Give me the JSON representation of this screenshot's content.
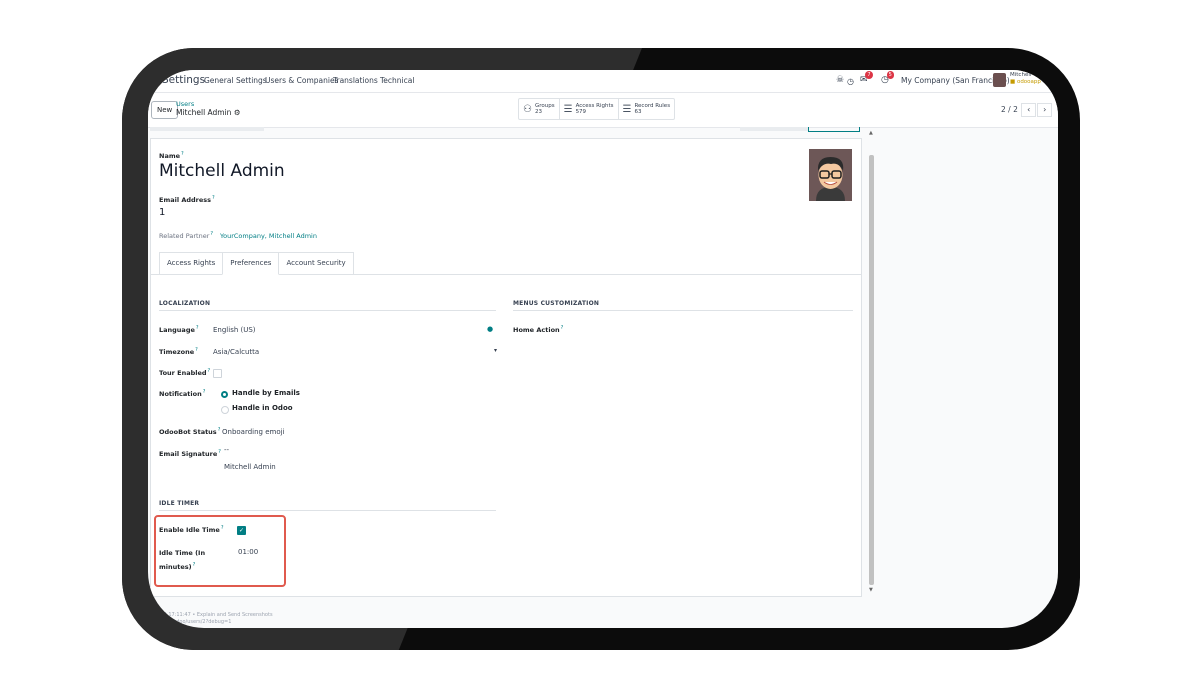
{
  "topnav": {
    "app_title": "Settings",
    "menu": [
      "General Settings",
      "Users & Companies",
      "Translations",
      "Technical"
    ],
    "notification_counts": {
      "messages": "7",
      "activities": "5"
    },
    "company": "My Company (San Francisco)",
    "user_name": "Mitchell",
    "user_db": "odooapp"
  },
  "controlbar": {
    "new_label": "New",
    "breadcrumb_parent": "Users",
    "breadcrumb_current": "Mitchell Admin",
    "smart_buttons": [
      {
        "label": "Groups",
        "value": "23",
        "icon": "users-icon"
      },
      {
        "label": "Access Rights",
        "value": "579",
        "icon": "list-icon"
      },
      {
        "label": "Record Rules",
        "value": "63",
        "icon": "list-icon"
      }
    ],
    "pager": "2 / 2"
  },
  "form": {
    "name_label": "Name",
    "name_value": "Mitchell Admin",
    "email_label": "Email Address",
    "email_value": "1",
    "partner_label": "Related Partner",
    "partner_value": "YourCompany, Mitchell Admin",
    "tabs": [
      "Access Rights",
      "Preferences",
      "Account Security"
    ],
    "active_tab": "Preferences"
  },
  "localization": {
    "title": "LOCALIZATION",
    "language_label": "Language",
    "language_value": "English (US)",
    "timezone_label": "Timezone",
    "timezone_value": "Asia/Calcutta",
    "tour_label": "Tour Enabled",
    "tour_enabled": false,
    "notification_label": "Notification",
    "notification_options": [
      "Handle by Emails",
      "Handle in Odoo"
    ],
    "notification_selected": "Handle by Emails",
    "odoobot_label": "OdooBot Status",
    "odoobot_value": "Onboarding emoji",
    "signature_label": "Email Signature",
    "signature_dash": "--",
    "signature_value": "Mitchell Admin"
  },
  "menus": {
    "title": "MENUS CUSTOMIZATION",
    "home_action_label": "Home Action"
  },
  "idle": {
    "title": "IDLE TIMER",
    "enable_label": "Enable Idle Time",
    "enabled": true,
    "time_label_1": "Idle Time (In",
    "time_label_2": "minutes)",
    "time_value": "01:00"
  },
  "footer": {
    "line1": "2024 17:11:47 • Explain and Send Screenshots",
    "line2": "...8069/odoo/users/2?debug=1"
  },
  "colors": {
    "accent": "#017e84",
    "highlight": "#e05a4e",
    "badge": "#dc3545"
  }
}
